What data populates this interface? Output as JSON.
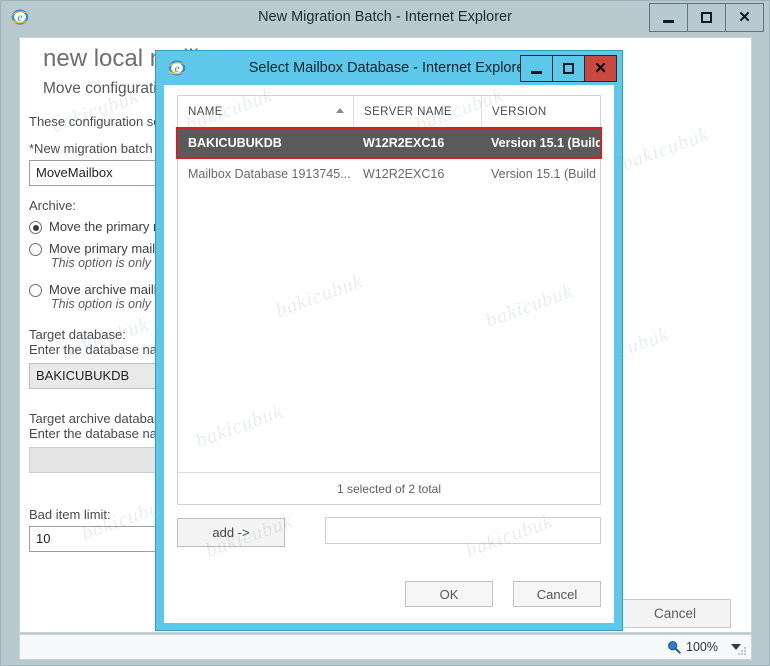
{
  "outer_window": {
    "title": "New Migration Batch - Internet Explorer",
    "app_icon": "internet-explorer-icon",
    "minimize_label": "Minimize",
    "maximize_label": "Maximize",
    "close_label": "Close"
  },
  "form": {
    "heading": "new local mailbox",
    "subheading": "Move configuration",
    "intro": "These configuration settin",
    "batch_name_label": "*New migration batch na",
    "batch_name_value": "MoveMailbox",
    "archive_label": "Archive:",
    "options": [
      {
        "label": "Move the primary ma",
        "selected": true,
        "hint": ""
      },
      {
        "label": "Move primary mailbo",
        "selected": false,
        "hint": "This option is only va"
      },
      {
        "label": "Move archive mailbox",
        "selected": false,
        "hint": "This option is only va"
      }
    ],
    "target_db_label": "Target database:",
    "target_db_sublabel": "Enter the database name",
    "target_db_value": "BAKICUBUKDB",
    "target_archive_db_label": "Target archive database:",
    "target_archive_db_sublabel": "Enter the database name",
    "target_archive_db_value": "",
    "bad_item_limit_label": "Bad item limit:",
    "bad_item_limit_value": "10",
    "cancel_label": "Cancel"
  },
  "statusbar": {
    "zoom_icon": "magnifier-icon",
    "zoom_level": "100%"
  },
  "dialog": {
    "title": "Select Mailbox Database - Internet Explorer",
    "app_icon": "internet-explorer-icon",
    "minimize_label": "Minimize",
    "maximize_label": "Maximize",
    "close_label": "Close",
    "table": {
      "columns": [
        "NAME",
        "SERVER NAME",
        "VERSION"
      ],
      "sort_column": "NAME",
      "sort_direction": "ascending",
      "rows": [
        {
          "name": "BAKICUBUKDB",
          "server_name": "W12R2EXC16",
          "version": "Version 15.1 (Build...",
          "selected": true
        },
        {
          "name": "Mailbox Database 1913745...",
          "server_name": "W12R2EXC16",
          "version": "Version 15.1 (Build ...",
          "selected": false
        }
      ],
      "footer": "1 selected of 2 total"
    },
    "add_button_label": "add ->",
    "selection_field_value": "",
    "ok_label": "OK",
    "cancel_label": "Cancel"
  },
  "watermark": {
    "text": "bakicubuk"
  },
  "colors": {
    "outer_titlebar": "#b9c9d0",
    "dialog_frame": "#5ec8ea",
    "close_button": "#c9483f",
    "selected_row_bg": "#5a5a5a",
    "selection_outline": "#d32020"
  }
}
